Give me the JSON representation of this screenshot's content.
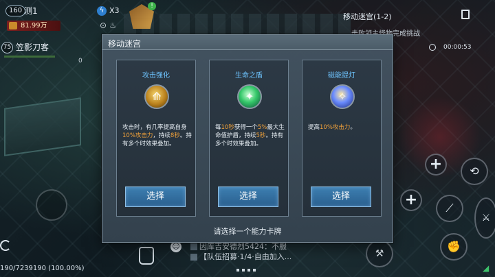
{
  "player": {
    "level": "160",
    "name": "测1",
    "power": "81.99万",
    "pet_level": "75",
    "pet_name": "笠影刀客",
    "energy": "X3",
    "small_number": "0"
  },
  "quest": {
    "title": "移动迷宫(1-2)",
    "description": "击败领主怪物完成挑战",
    "timer": "00:00:53"
  },
  "modal": {
    "title": "移动迷宫",
    "hint": "请选择一个能力卡牌",
    "cards": [
      {
        "name": "攻击强化",
        "icon": "sword-emblem-icon",
        "desc_parts": [
          "攻击时，有几率提高自身",
          "10%攻击力",
          "，持续",
          "8秒",
          "。持有多个时效果叠加。"
        ],
        "button": "选择"
      },
      {
        "name": "生命之盾",
        "icon": "green-shield-orb-icon",
        "desc_parts": [
          "每",
          "10秒",
          "获得一个",
          "5%",
          "最大生命值护盾，持续",
          "5秒",
          "。持有多个时效果叠加。"
        ],
        "button": "选择"
      },
      {
        "name": "磁能提灯",
        "icon": "lantern-orb-icon",
        "desc_parts": [
          "提高",
          "10%攻击力",
          "。"
        ],
        "button": "选择"
      }
    ]
  },
  "bottom": {
    "exp": "190/7239190 (100.00%)",
    "chat_line1": "因库吉安德烈5424：不服",
    "chat_line2": "【队伍招募·1/4·自由加入..."
  },
  "colors": {
    "highlight": "#f2a23a",
    "card_title": "#6ec4ff",
    "button": "#2f6a9a"
  }
}
